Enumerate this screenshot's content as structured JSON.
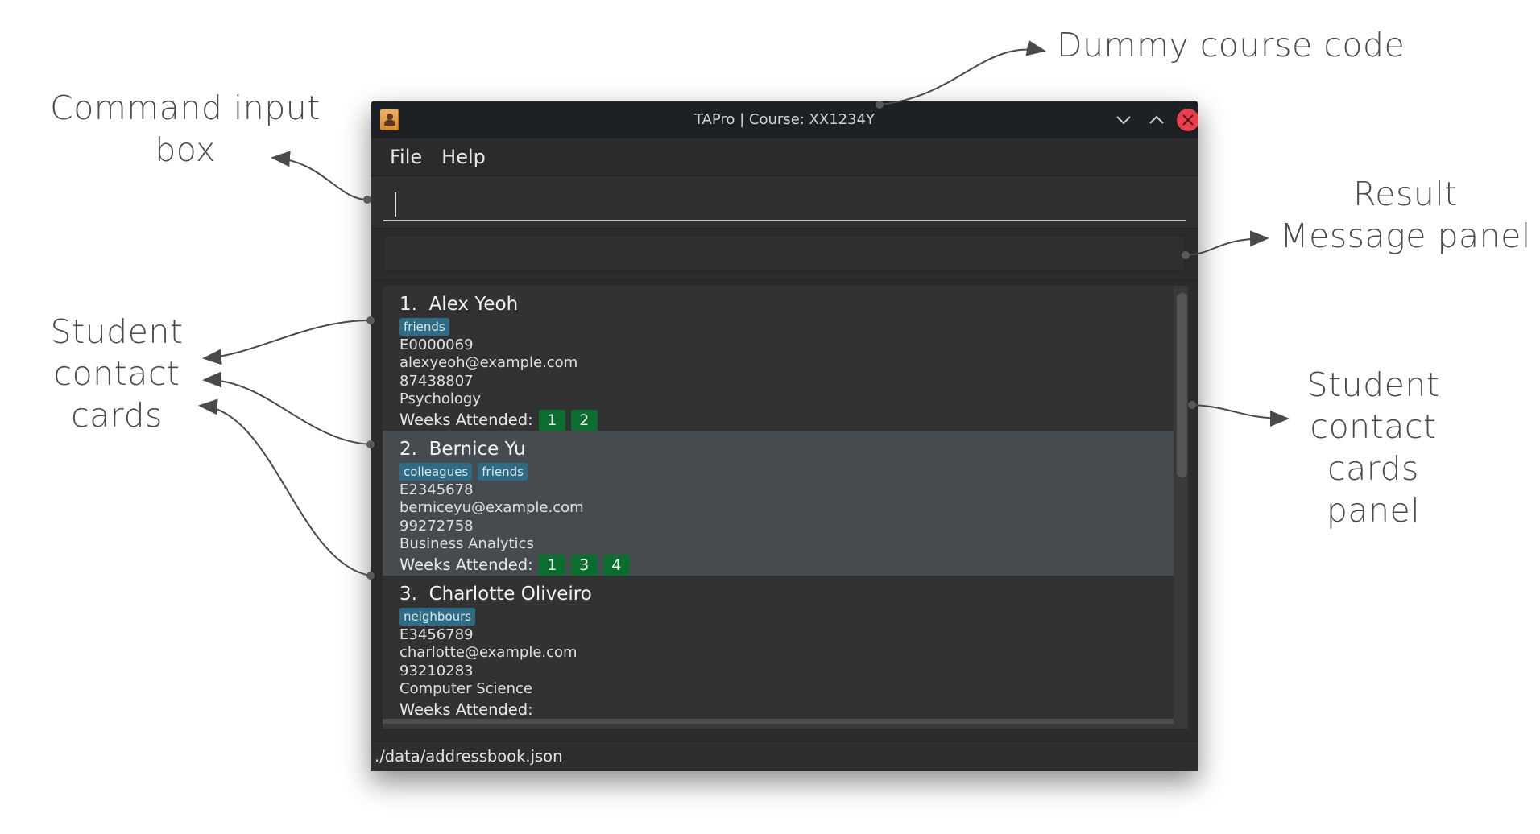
{
  "annotations": {
    "dummy_course_code": "Dummy course code",
    "command_input_box": [
      "Command input",
      "box"
    ],
    "result_message_panel": [
      "Result",
      "Message panel"
    ],
    "student_contact_cards": [
      "Student",
      "contact",
      "cards"
    ],
    "student_contact_cards_panel": [
      "Student",
      "contact",
      "cards",
      "panel"
    ]
  },
  "window": {
    "title": "TAPro | Course: XX1234Y",
    "icons": {
      "app": "address-book-icon",
      "minimize": "chevron-down-icon",
      "maximize": "chevron-up-icon",
      "close": "close-icon"
    }
  },
  "menu": {
    "items": [
      "File",
      "Help"
    ]
  },
  "command_box": {
    "value": "",
    "placeholder": ""
  },
  "result_panel": {
    "message": ""
  },
  "students": [
    {
      "index_name": "1.  Alex Yeoh",
      "tags": [
        "friends"
      ],
      "student_id": "E0000069",
      "email": "alexyeoh@example.com",
      "phone": "87438807",
      "major": "Psychology",
      "weeks_label": "Weeks Attended:",
      "weeks": [
        "1",
        "2"
      ]
    },
    {
      "index_name": "2.  Bernice Yu",
      "tags": [
        "colleagues",
        "friends"
      ],
      "student_id": "E2345678",
      "email": "berniceyu@example.com",
      "phone": "99272758",
      "major": "Business Analytics",
      "weeks_label": "Weeks Attended:",
      "weeks": [
        "1",
        "3",
        "4"
      ]
    },
    {
      "index_name": "3.  Charlotte Oliveiro",
      "tags": [
        "neighbours"
      ],
      "student_id": "E3456789",
      "email": "charlotte@example.com",
      "phone": "93210283",
      "major": "Computer Science",
      "weeks_label": "Weeks Attended:",
      "weeks": []
    }
  ],
  "colors": {
    "tag_bg": "#2f6b84",
    "week_badge_bg": "#0b6e2f",
    "close_button": "#e8404f",
    "selected_card_bg": "#454b4e"
  },
  "status_bar": {
    "file_path": "./data/addressbook.json"
  }
}
